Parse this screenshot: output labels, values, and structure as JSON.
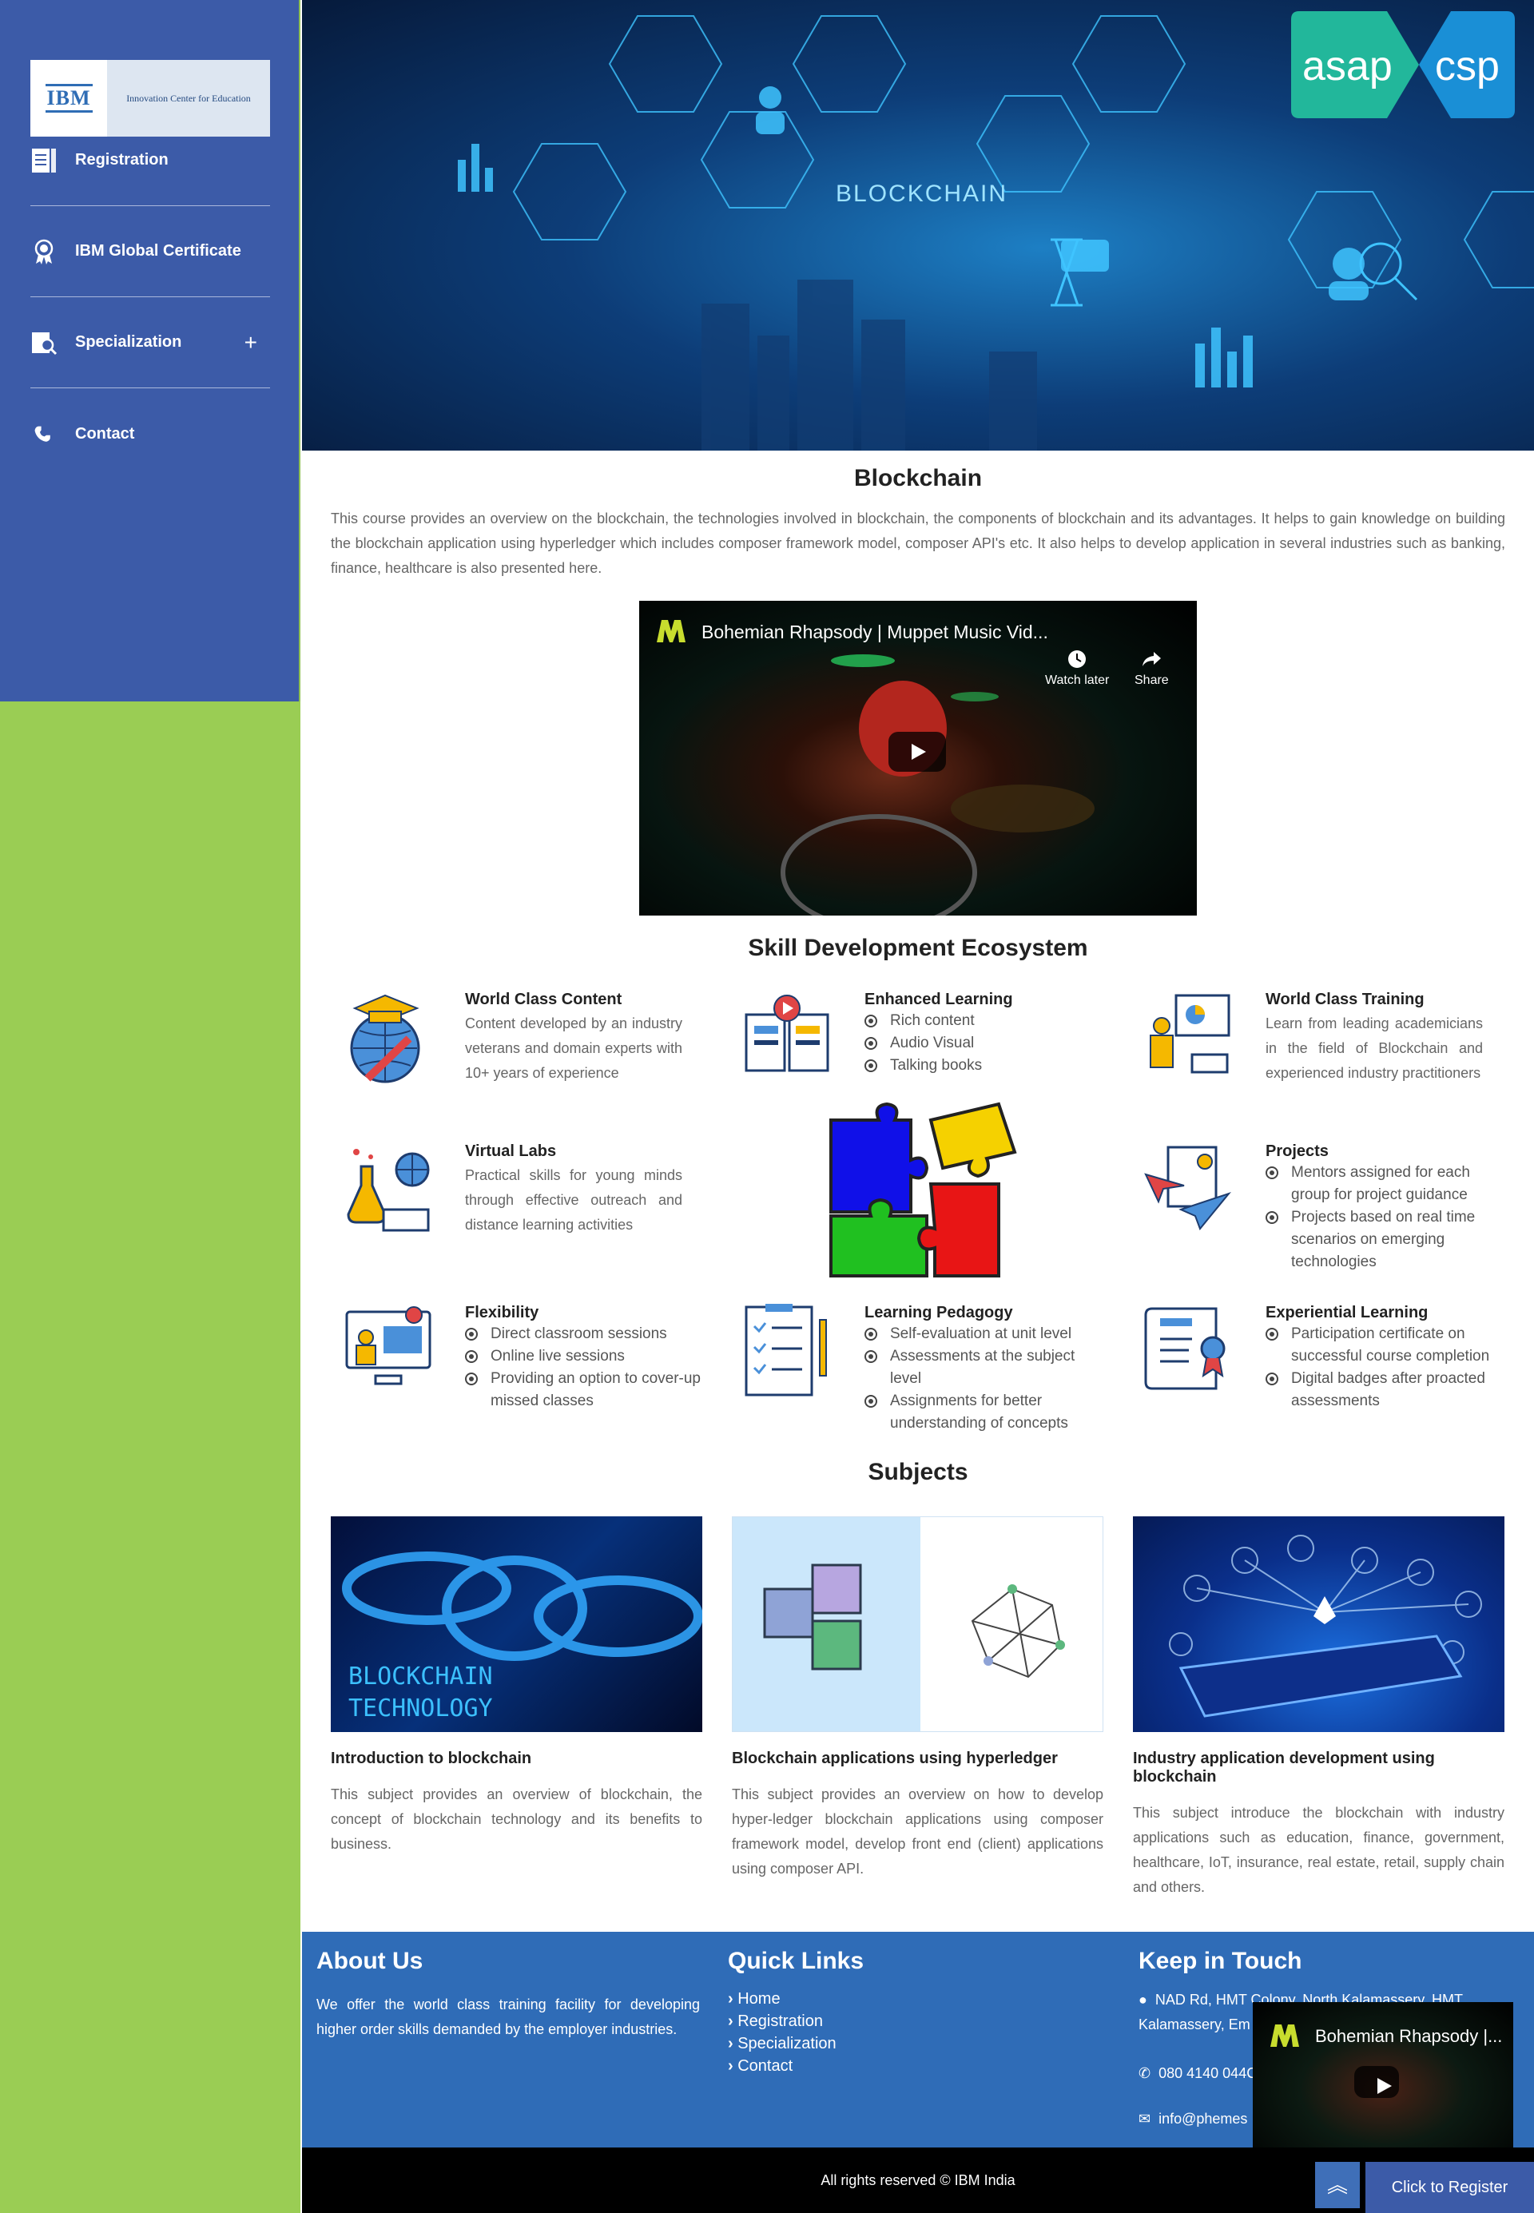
{
  "sidebar": {
    "logo": {
      "ibm": "IBM",
      "center": "Innovation Center for Education"
    },
    "items": [
      {
        "label": "Registration",
        "icon": "form-icon"
      },
      {
        "label": "IBM Global Certificate",
        "icon": "certificate-icon"
      },
      {
        "label": "Specialization",
        "icon": "search-doc-icon",
        "expander": "+"
      },
      {
        "label": "Contact",
        "icon": "phone-icon"
      }
    ]
  },
  "hero": {
    "text": "BLOCKCHAIN",
    "logo": {
      "left": "asap",
      "right": "csp"
    }
  },
  "course": {
    "title": "Blockchain",
    "intro": "This course provides an overview on the blockchain, the technologies involved in blockchain, the components of blockchain and its advantages. It helps to gain knowledge on building the blockchain application using hyperledger which includes composer framework model, composer API's etc. It also helps to develop application in several industries such as banking, finance, healthcare is also presented here."
  },
  "video": {
    "title": "Bohemian Rhapsody | Muppet Music Vid...",
    "watch_later": "Watch later",
    "share": "Share"
  },
  "ecosystem": {
    "title": "Skill Development Ecosystem",
    "features": [
      {
        "title": "World Class Content",
        "text": "Content developed by an industry veterans and domain experts with 10+ years of experience"
      },
      {
        "title": "Enhanced Learning",
        "list": [
          "Rich content",
          "Audio Visual",
          "Talking books"
        ]
      },
      {
        "title": "World Class Training",
        "text": "Learn from leading academicians in the field of Blockchain and experienced industry practitioners"
      },
      {
        "title": "Virtual Labs",
        "text": "Practical skills for young minds through effective outreach and distance learning activities"
      },
      {
        "title": "Projects",
        "list": [
          "Mentors assigned for each group for project guidance",
          "Projects based on real time scenarios on emerging technologies"
        ]
      },
      {
        "title": "Flexibility",
        "list": [
          "Direct classroom sessions",
          "Online live sessions",
          "Providing an option to cover-up missed classes"
        ]
      },
      {
        "title": "Learning Pedagogy",
        "list": [
          "Self-evaluation at unit level",
          "Assessments at the subject level",
          "Assignments for better understanding of concepts"
        ]
      },
      {
        "title": "Experiential Learning",
        "list": [
          "Participation certificate on successful course completion",
          "Digital badges after proacted assessments"
        ]
      }
    ]
  },
  "subjects": {
    "title": "Subjects",
    "items": [
      {
        "title": "Introduction to blockchain",
        "image_text": [
          "BLOCKCHAIN",
          "TECHNOLOGY"
        ],
        "text": "This subject provides an overview of blockchain, the concept of blockchain technology and its benefits to business."
      },
      {
        "title": "Blockchain applications using hyperledger",
        "text": "This subject provides an overview on how to develop hyper-ledger blockchain applications using composer framework model, develop front end (client) applications using composer API."
      },
      {
        "title": "Industry application development using blockchain",
        "text": "This subject introduce the blockchain with industry applications such as education, finance, government, healthcare, IoT, insurance, real estate, retail, supply chain and others."
      }
    ]
  },
  "footer": {
    "about": {
      "title": "About Us",
      "text": "We offer the world class training facility for developing higher order skills demanded by the employer industries."
    },
    "links": {
      "title": "Quick Links",
      "items": [
        "Home",
        "Registration",
        "Specialization",
        "Contact"
      ]
    },
    "touch": {
      "title": "Keep in Touch",
      "address_line1": "NAD Rd, HMT Colony, North Kalamassery, HMT",
      "address_line2": "Kalamassery, Em",
      "phone": "080 4140 044C",
      "email": "info@phemes"
    },
    "copyright": "All rights reserved © IBM India"
  },
  "mini_player": {
    "title": "Bohemian Rhapsody |..."
  },
  "register_button": "Click to Register",
  "colors": {
    "sidebar": "#3c5ba8",
    "sidebar_lower": "#9acd54",
    "footer": "#2f6cb7",
    "hero": "#0d3d78"
  }
}
